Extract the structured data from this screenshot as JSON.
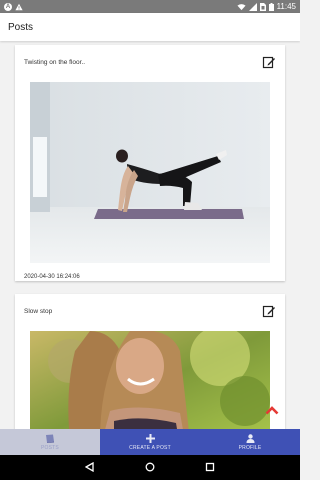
{
  "status_bar": {
    "left_icons": [
      "notification-a-icon",
      "warning-icon"
    ],
    "right_icons": [
      "wifi-icon",
      "signal-icon",
      "sim-icon",
      "battery-icon"
    ],
    "time": "11:45"
  },
  "app_bar": {
    "title": "Posts"
  },
  "posts": [
    {
      "title": "Twisting on the floor..",
      "date": "2020-04-30 16:24:06",
      "image": "yoga-woman-photo"
    },
    {
      "title": "Slow stop",
      "date": "",
      "image": "smiling-woman-photo"
    }
  ],
  "bottom_nav": {
    "items": [
      {
        "label": "POSTS",
        "icon": "book-icon",
        "active": true
      },
      {
        "label": "CREATE A POST",
        "icon": "plus-icon",
        "active": false
      },
      {
        "label": "PROFILE",
        "icon": "person-icon",
        "active": false
      }
    ]
  },
  "colors": {
    "primary": "#3f51b5",
    "accent": "#e53935",
    "status_bar": "#7a7a7a",
    "background": "#f2f2f2"
  }
}
